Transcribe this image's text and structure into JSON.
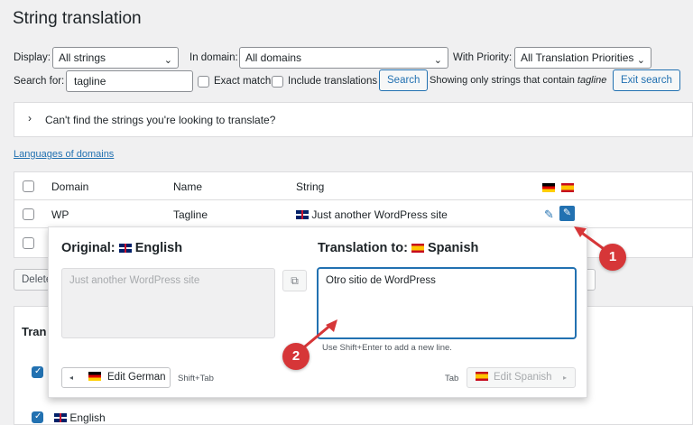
{
  "page_title": "String translation",
  "filters": {
    "display_label": "Display:",
    "display_value": "All strings",
    "domain_label": "In domain:",
    "domain_value": "All domains",
    "priority_label": "With Priority:",
    "priority_value": "All Translation Priorities",
    "search_label": "Search for:",
    "search_value": "tagline",
    "exact_match_label": "Exact match",
    "include_translations_label": "Include translations",
    "search_button": "Search",
    "showing_prefix": "Showing only strings that contain",
    "showing_term": "tagline",
    "exit_search_button": "Exit search"
  },
  "collapsible": {
    "label": "Can't find the strings you're looking to translate?"
  },
  "languages_link": "Languages of domains",
  "table": {
    "headers": {
      "domain": "Domain",
      "name": "Name",
      "string": "String"
    },
    "row": {
      "domain": "WP",
      "name": "Tagline",
      "string": "Just another WordPress site"
    }
  },
  "bottom": {
    "delete_stub": "Delete",
    "section_stub": "Tran",
    "english_label": "English"
  },
  "popup": {
    "original_label": "Original:",
    "original_language": "English",
    "translation_label": "Translation to:",
    "translation_language": "Spanish",
    "original_text": "Just another WordPress site",
    "translation_text": "Otro sitio de WordPress",
    "hint": "Use Shift+Enter to add a new line.",
    "prev_button": "Edit German",
    "prev_shortcut": "Shift+Tab",
    "next_shortcut": "Tab",
    "next_button": "Edit Spanish"
  },
  "markers": {
    "one": "1",
    "two": "2"
  },
  "colors": {
    "accent": "#2271b1",
    "marker": "#d63638"
  }
}
